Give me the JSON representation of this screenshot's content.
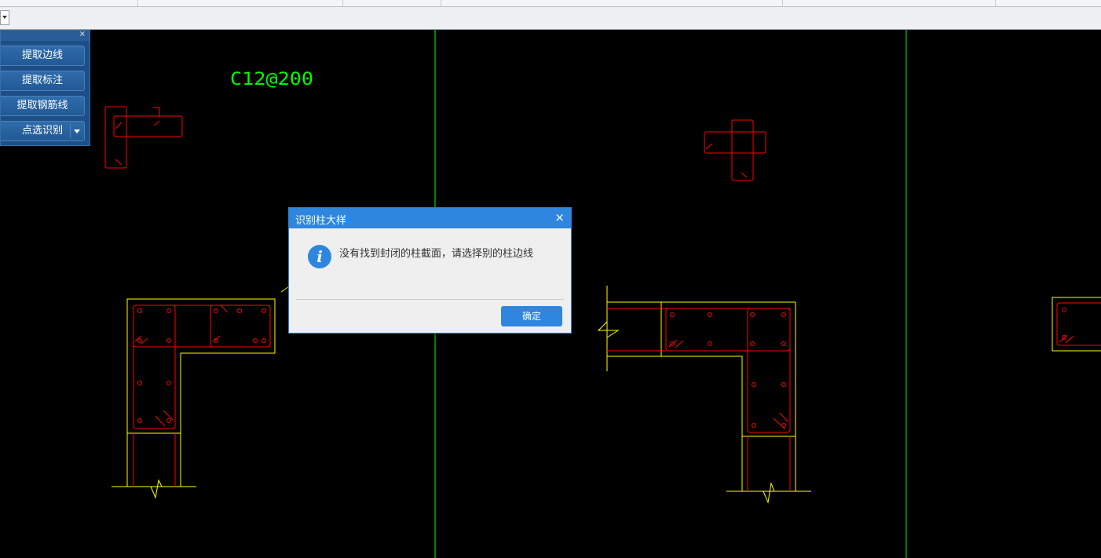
{
  "colors": {
    "canvas": "#000000",
    "axis_line": "#00ff00",
    "column_outline": "#ffff00",
    "rebar": "#ff0000",
    "annotation_text": "#00ff00",
    "dialog_accent": "#2e86de",
    "panel_bg": "#1d4e86"
  },
  "toolbar": {
    "dropdown_icon": "chevron-down-icon"
  },
  "side_panel": {
    "close_icon": "×",
    "buttons": {
      "extract_edges": "提取边线",
      "extract_labels": "提取标注",
      "extract_rebar_lines": "提取钢筋线",
      "point_select_identify": "点选识别"
    }
  },
  "canvas": {
    "annotation": "C12@200"
  },
  "dialog": {
    "title": "识别柱大样",
    "close_icon": "×",
    "icon": "info-icon",
    "icon_glyph": "i",
    "message": "没有找到封闭的柱截面，请选择别的柱边线",
    "ok_label": "确定"
  }
}
